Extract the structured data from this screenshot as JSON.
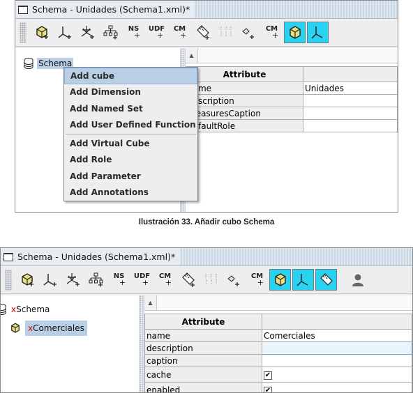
{
  "figure1": {
    "window_title": "Schema - Unidades (Schema1.xml)*",
    "tree_root": "Schema",
    "context_menu": [
      "Add cube",
      "Add Dimension",
      "Add Named Set",
      "Add User Defined Function",
      "Add Virtual Cube",
      "Add Role",
      "Add Parameter",
      "Add Annotations"
    ],
    "highlighted_menu_item": "Add cube",
    "table_header": "Attribute",
    "attributes": [
      {
        "name": "name",
        "value": "Unidades"
      },
      {
        "name": "description",
        "value": ""
      },
      {
        "name": "measuresCaption",
        "value": ""
      },
      {
        "name": "defaultRole",
        "value": ""
      }
    ]
  },
  "caption": "Ilustración 33. Añadir cubo Schema",
  "figure2": {
    "window_title": "Schema - Unidades (Schema1.xml)*",
    "tree_root_prefix": "x",
    "tree_root": "Schema",
    "tree_child_prefix": "x",
    "tree_child": "Comerciales",
    "table_header": "Attribute",
    "attributes": [
      {
        "name": "name",
        "value": "Comerciales"
      },
      {
        "name": "description",
        "value": ""
      },
      {
        "name": "caption",
        "value": ""
      },
      {
        "name": "cache",
        "value": "✔"
      },
      {
        "name": "enabled",
        "value": "✔"
      }
    ]
  },
  "toolbar_icons": [
    "add-cube-icon",
    "add-dimension-icon",
    "add-hierarchy-icon",
    "add-level-icon",
    "add-named-set-icon",
    "add-udf-icon",
    "add-calculated-member-icon",
    "add-measure-icon",
    "add-measure-group-icon",
    "add-property-icon",
    "add-cube-measure-icon"
  ],
  "toolbar_text_labels": {
    "ns": "NS",
    "udf": "UDF",
    "cm": "CM",
    "plus": "+"
  },
  "colors": {
    "accent_cyan": "#27d3f0",
    "selection": "#b8cfe5",
    "error_x": "#d40000"
  }
}
